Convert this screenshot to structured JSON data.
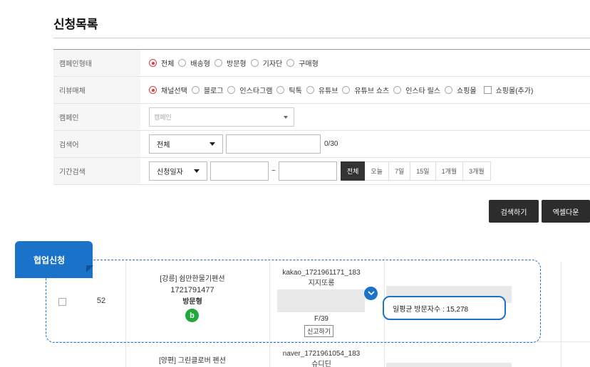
{
  "page_title": "신청목록",
  "filters": {
    "campaign_type": {
      "label": "캠페인형태",
      "options": [
        "전체",
        "배송형",
        "방문형",
        "기자단",
        "구매형"
      ],
      "selected": "전체"
    },
    "review_media": {
      "label": "리뷰매체",
      "options": [
        "채널선택",
        "블로그",
        "인스타그램",
        "틱톡",
        "유튜브",
        "유튜브 쇼츠",
        "인스타 릴스",
        "쇼핑몰"
      ],
      "selected": "채널선택",
      "checkbox_label": "쇼핑몰(추가)"
    },
    "campaign": {
      "label": "캠페인",
      "placeholder": "캠페인"
    },
    "keyword": {
      "label": "검색어",
      "select_value": "전체",
      "counter": "0/30"
    },
    "period": {
      "label": "기간검색",
      "select_value": "신청일자",
      "separator": "~",
      "buttons": [
        "전체",
        "오늘",
        "7일",
        "15일",
        "1개월",
        "3개월"
      ],
      "selected": "전체"
    }
  },
  "actions": {
    "search_label": "검색하기",
    "excel_label": "엑셀다운"
  },
  "ribbon_label": "협업신청",
  "rows": [
    {
      "number": "52",
      "campaign_title": "[강릉] 쉼만한물기펜션",
      "campaign_id": "1721791477",
      "campaign_type": "방문형",
      "badge": "b",
      "applicant_id": "kakao_1721961171_183",
      "applicant_name": "지지또롱",
      "gender_age": "F/39",
      "report_label": "신고하기",
      "stat_text": "일평균 방문자수 : 15,278"
    },
    {
      "campaign_title": "[양편] 그린클로버 펜션",
      "applicant_id": "naver_1721961054_183",
      "applicant_name": "슈디딘"
    }
  ],
  "colors": {
    "accent_blue": "#1a73c8",
    "radio_selected": "#e23b3b",
    "naver_green": "#1fa83c",
    "dark_button": "#2c2c2c"
  }
}
